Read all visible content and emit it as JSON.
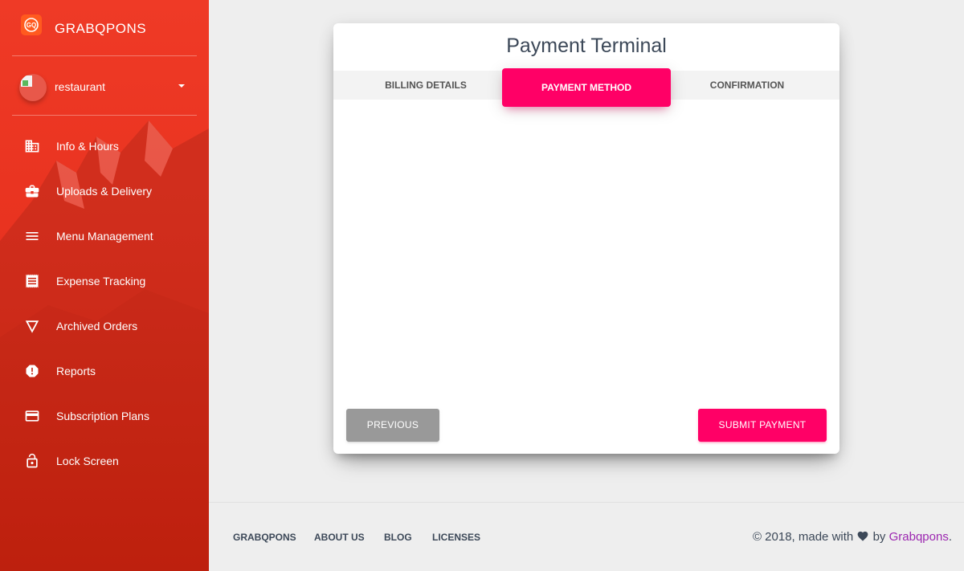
{
  "sidebar": {
    "brand": "GRABQPONS",
    "logo_text": "GQ",
    "user": {
      "name": "restaurant"
    },
    "items": [
      {
        "label": "Info & Hours",
        "icon": "building-icon"
      },
      {
        "label": "Uploads & Delivery",
        "icon": "briefcase-icon"
      },
      {
        "label": "Menu Management",
        "icon": "menu-icon"
      },
      {
        "label": "Expense Tracking",
        "icon": "receipt-icon"
      },
      {
        "label": "Archived Orders",
        "icon": "triangle-down-icon"
      },
      {
        "label": "Reports",
        "icon": "alert-octagon-icon"
      },
      {
        "label": "Subscription Plans",
        "icon": "credit-card-icon"
      },
      {
        "label": "Lock Screen",
        "icon": "lock-open-icon"
      }
    ]
  },
  "card": {
    "title": "Payment Terminal",
    "tabs": [
      {
        "label": "BILLING DETAILS",
        "active": false
      },
      {
        "label": "PAYMENT METHOD",
        "active": true
      },
      {
        "label": "CONFIRMATION",
        "active": false
      }
    ],
    "previous_label": "PREVIOUS",
    "submit_label": "SUBMIT PAYMENT"
  },
  "footer": {
    "links": [
      "GRABQPONS",
      "ABOUT US",
      "BLOG",
      "LICENSES"
    ],
    "copyright_prefix": "© 2018, made with",
    "copyright_by": "by",
    "copyright_brand": "Grabqpons",
    "copyright_suffix": "."
  },
  "colors": {
    "sidebar_red": "#e8321f",
    "accent_pink": "#ff0066",
    "button_gray": "#999999",
    "link_purple": "#9c27b0"
  }
}
